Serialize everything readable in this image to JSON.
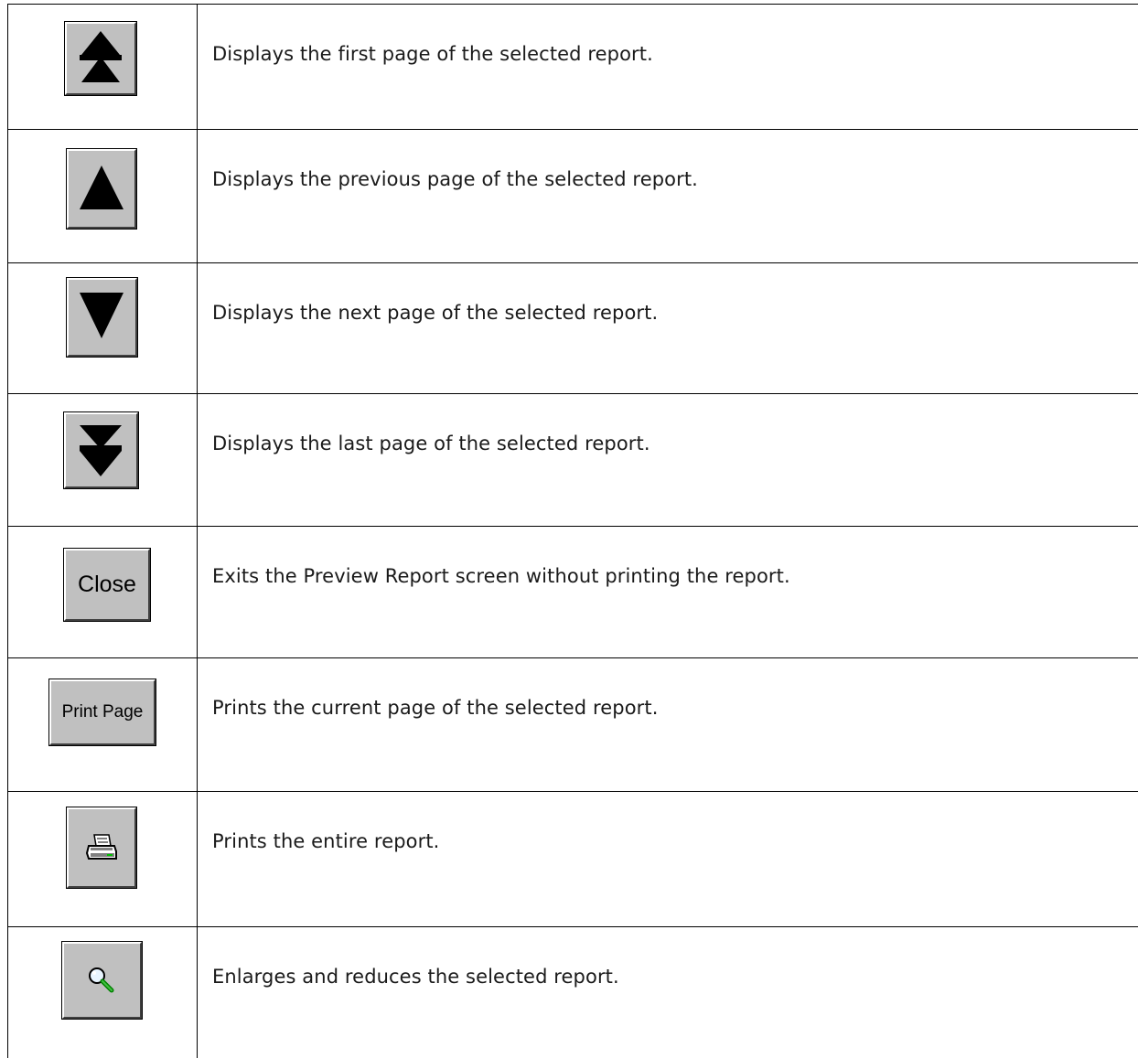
{
  "rows": [
    {
      "icon": "first-page-icon",
      "description": "Displays the first page of the selected report."
    },
    {
      "icon": "previous-page-icon",
      "description": "Displays the previous page of the selected report."
    },
    {
      "icon": "next-page-icon",
      "description": "Displays the next page of the selected report."
    },
    {
      "icon": "last-page-icon",
      "description": "Displays the last page of the selected report."
    },
    {
      "icon": "close-button",
      "label": "Close",
      "description": "Exits the Preview Report screen without printing the report."
    },
    {
      "icon": "print-page-button",
      "label": "Print Page",
      "description": "Prints the current page of the selected report."
    },
    {
      "icon": "printer-icon",
      "description": "Prints the entire report."
    },
    {
      "icon": "magnifier-icon",
      "description": "Enlarges and reduces the selected report."
    }
  ]
}
